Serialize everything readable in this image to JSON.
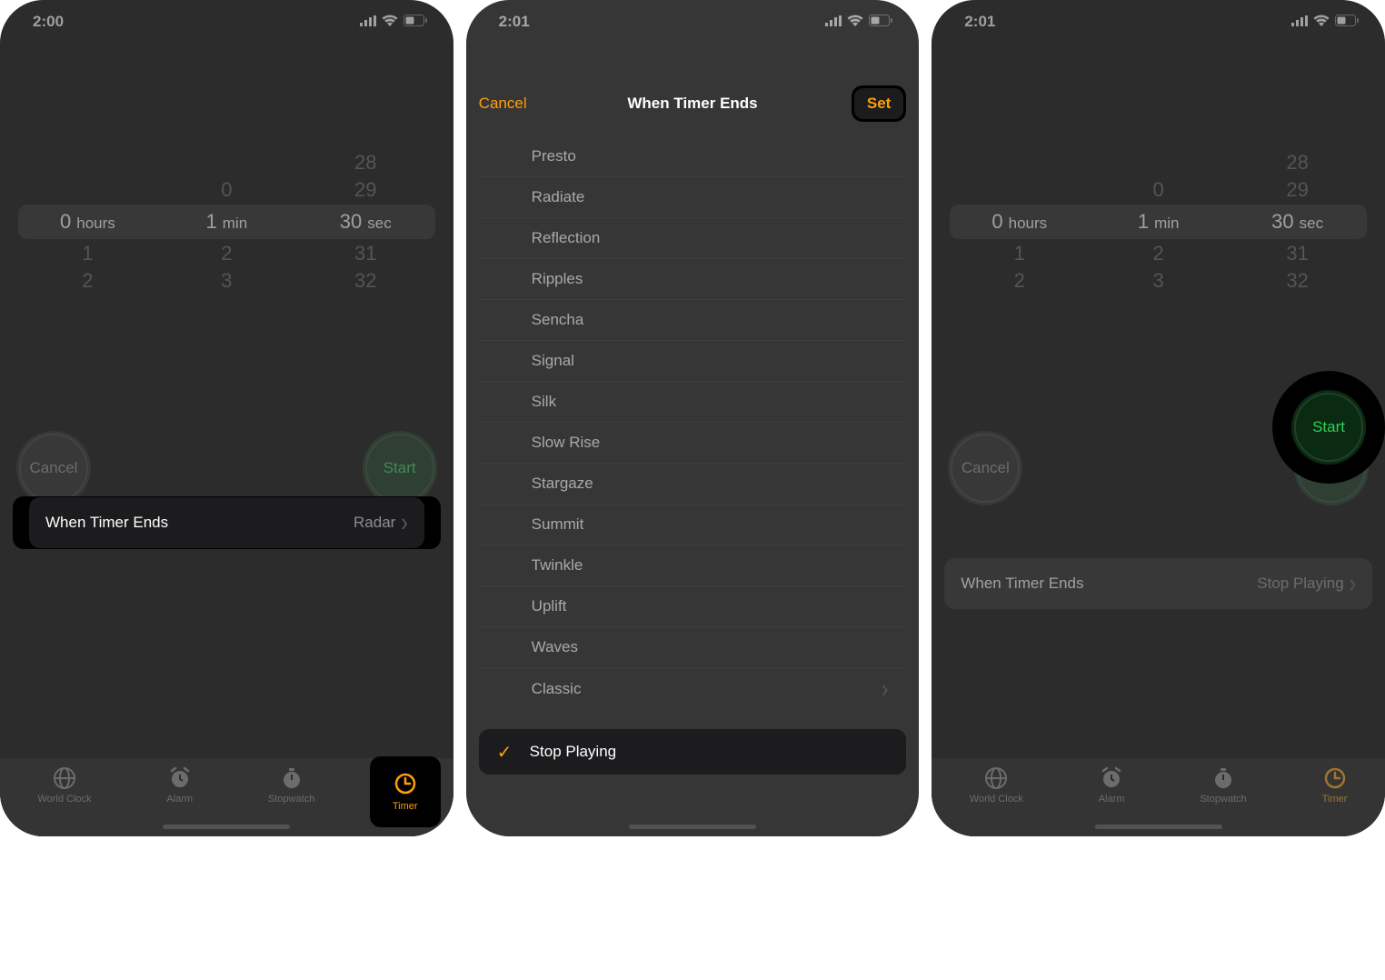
{
  "status": {
    "time1": "2:00",
    "time2": "2:01",
    "time3": "2:01"
  },
  "picker": {
    "hours": {
      "pre2": "",
      "pre1": "",
      "sel": "0",
      "unit": "hours",
      "post1": "1",
      "post2": "2"
    },
    "mins": {
      "pre2": "",
      "pre1": "0",
      "sel": "1",
      "unit": "min",
      "post1": "2",
      "post2": "3"
    },
    "secs": {
      "pre2": "28",
      "pre1": "29",
      "sel": "30",
      "unit": "sec",
      "post1": "31",
      "post2": "32"
    }
  },
  "buttons": {
    "cancel": "Cancel",
    "start": "Start"
  },
  "when": {
    "label": "When Timer Ends",
    "value1": "Radar",
    "value3": "Stop Playing"
  },
  "sheet": {
    "cancel": "Cancel",
    "title": "When Timer Ends",
    "set": "Set",
    "sounds": [
      "Presto",
      "Radiate",
      "Reflection",
      "Ripples",
      "Sencha",
      "Signal",
      "Silk",
      "Slow Rise",
      "Stargaze",
      "Summit",
      "Twinkle",
      "Uplift",
      "Waves",
      "Classic"
    ],
    "stop": "Stop Playing"
  },
  "tabs": {
    "worldclock": "World Clock",
    "alarm": "Alarm",
    "stopwatch": "Stopwatch",
    "timer": "Timer"
  }
}
